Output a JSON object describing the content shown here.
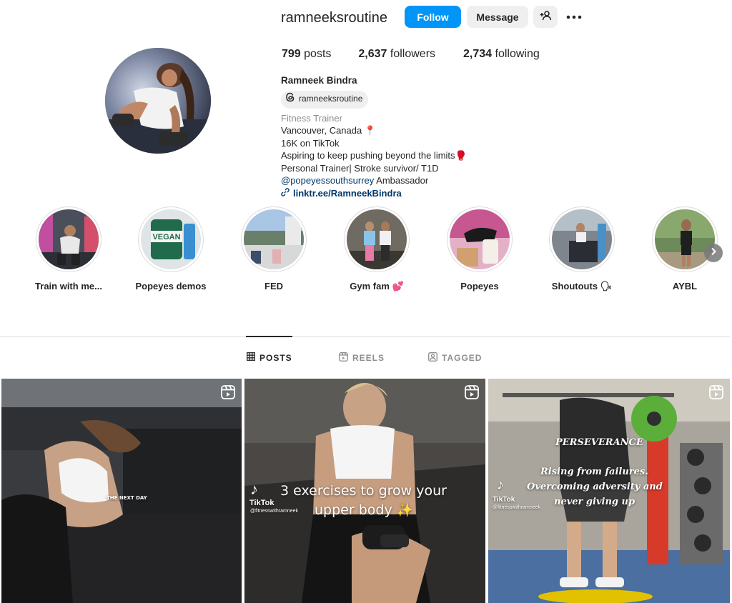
{
  "profile": {
    "username": "ramneeksroutine",
    "follow_label": "Follow",
    "message_label": "Message",
    "posts_count": "799",
    "posts_label": " posts",
    "followers_count": "2,637",
    "followers_label": " followers",
    "following_count": "2,734",
    "following_label": " following",
    "full_name": "Ramneek Bindra",
    "threads_handle": "ramneeksroutine",
    "category": "Fitness Trainer",
    "bio_line1": "Vancouver, Canada 📍",
    "bio_line2": "16K on TikTok",
    "bio_line3": "Aspiring to keep pushing beyond the limits🥊",
    "bio_line4": "Personal Trainer| Stroke survivor/ T1D",
    "mention": "@popeyessouthsurrey",
    "mention_suffix": " Ambassador",
    "link": "linktr.ee/RamneekBindra"
  },
  "highlights": [
    {
      "label": "Train with me..."
    },
    {
      "label": "Popeyes demos"
    },
    {
      "label": "FED"
    },
    {
      "label": "Gym fam 💕"
    },
    {
      "label": "Popeyes"
    },
    {
      "label": "Shoutouts 🗣"
    },
    {
      "label": "AYBL"
    }
  ],
  "tabs": {
    "posts": "POSTS",
    "reels": "REELS",
    "tagged": "TAGGED"
  },
  "posts": [
    {
      "overlay": "THE NEXT DAY"
    },
    {
      "overlay_line1": "3 exercises to grow your",
      "overlay_line2": "upper body ✨",
      "tiktok": "TikTok",
      "tiktok_handle": "@fitnesswithramneek"
    },
    {
      "overlay_title": "PERSEVERANCE",
      "overlay_line1": "Rising from failures.",
      "overlay_line2": "Overcoming adversity and",
      "overlay_line3": "never giving up",
      "tiktok": "TikTok",
      "tiktok_handle": "@fitnesswithramneek"
    }
  ],
  "colors": {
    "accent": "#0095f6",
    "link": "#00376b",
    "secondary_text": "#8e8e8e"
  }
}
